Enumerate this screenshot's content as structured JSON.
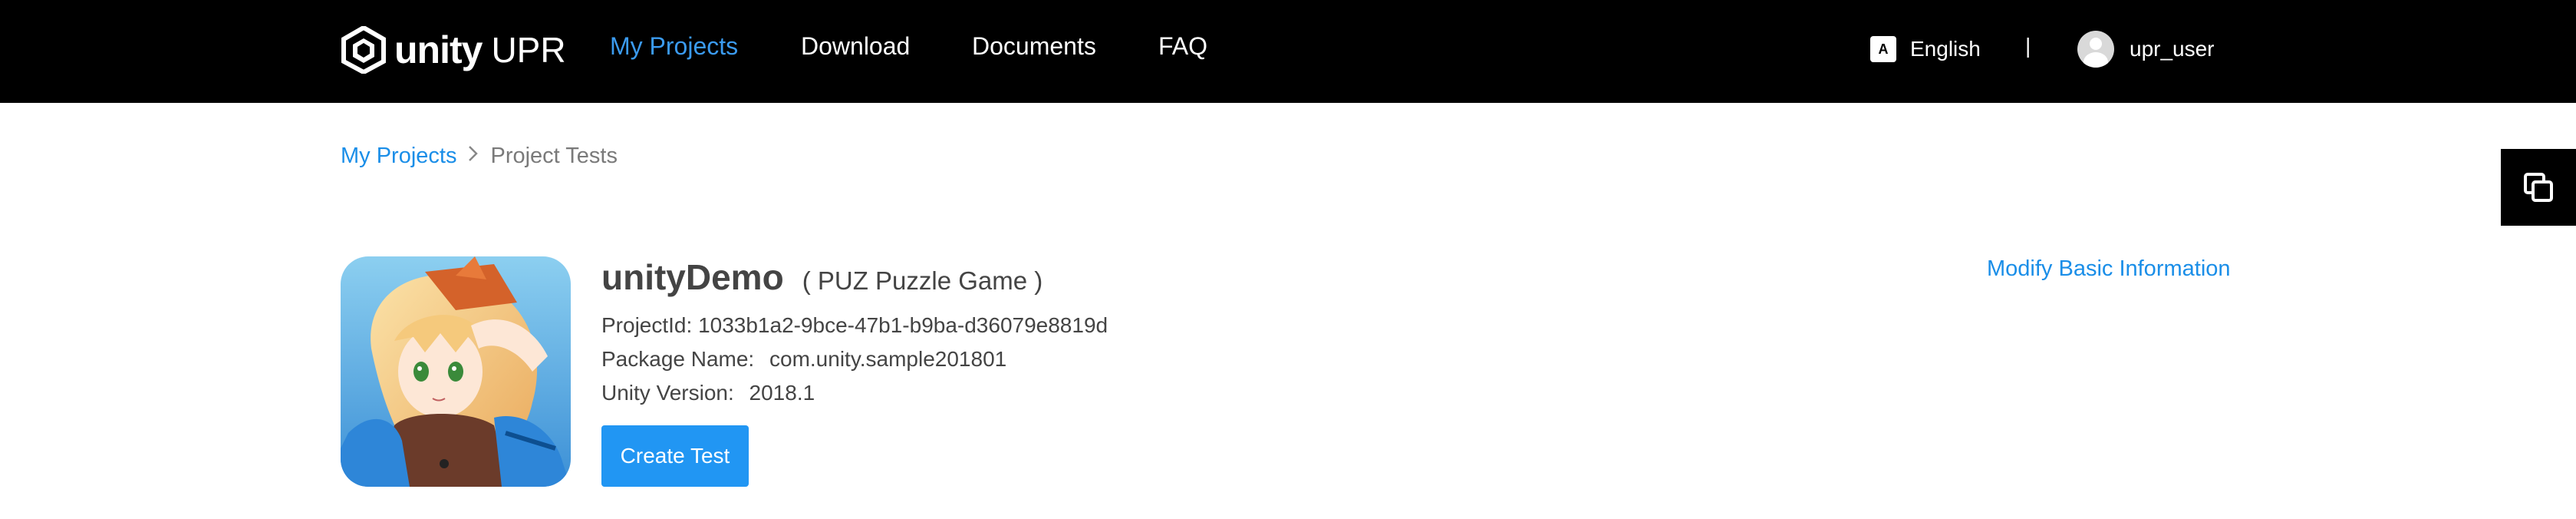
{
  "header": {
    "brand": "unity",
    "brand_suffix": "UPR",
    "nav": [
      {
        "label": "My Projects",
        "active": true
      },
      {
        "label": "Download",
        "active": false
      },
      {
        "label": "Documents",
        "active": false
      },
      {
        "label": "FAQ",
        "active": false
      }
    ],
    "language": "English",
    "divider": "|",
    "username": "upr_user"
  },
  "breadcrumb": {
    "parent": "My Projects",
    "current": "Project Tests"
  },
  "project": {
    "name": "unityDemo",
    "genre": "( PUZ Puzzle Game )",
    "project_id_label": "ProjectId:",
    "project_id": "1033b1a2-9bce-47b1-b9ba-d36079e8819d",
    "package_label": "Package Name:",
    "package_name": "com.unity.sample201801",
    "version_label": "Unity Version:",
    "version": "2018.1",
    "create_test_label": "Create Test",
    "modify_label": "Modify Basic Information"
  },
  "colors": {
    "topbar": "#000000",
    "accent": "#2196f3",
    "link": "#1a8ee8"
  },
  "icons": {
    "logo": "unity-logo-icon",
    "language": "translate-icon",
    "avatar": "user-avatar-icon",
    "breadcrumb_separator": "chevron-right-icon",
    "side_button": "copy-window-icon"
  }
}
